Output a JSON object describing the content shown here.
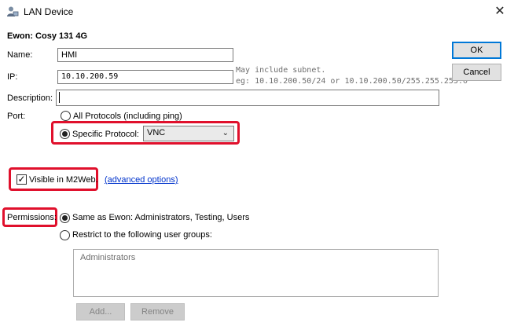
{
  "window": {
    "title": "LAN Device",
    "close_glyph": "✕",
    "icon": "user-device-icon"
  },
  "device_heading": "Ewon: Cosy 131 4G",
  "fields": {
    "name_label": "Name:",
    "name_value": "HMI",
    "ip_label": "IP:",
    "ip_value": "10.10.200.59",
    "ip_hint_line1": "May include subnet.",
    "ip_hint_line2": "eg: 10.10.200.50/24 or 10.10.200.50/255.255.255.0",
    "description_label": "Description:",
    "description_value": ""
  },
  "port": {
    "label": "Port:",
    "all_protocols_label": "All Protocols (including ping)",
    "all_protocols_selected": false,
    "specific_protocol_label": "Specific Protocol:",
    "specific_protocol_selected": true,
    "protocol_value": "VNC"
  },
  "visibility": {
    "visible_label": "Visible in M2Web.",
    "visible_checked": true,
    "advanced_link": "(advanced options)"
  },
  "permissions": {
    "label": "Permissions:",
    "same_as_label": "Same as Ewon: Administrators, Testing, Users",
    "same_as_selected": true,
    "restrict_label": "Restrict to the following user groups:",
    "restrict_selected": false,
    "groups": [
      "Administrators"
    ],
    "add_label": "Add...",
    "remove_label": "Remove"
  },
  "buttons": {
    "ok": "OK",
    "cancel": "Cancel"
  },
  "colors": {
    "highlight_red": "#e0102c",
    "link_blue": "#0033cc",
    "default_button_border": "#0078d7"
  }
}
